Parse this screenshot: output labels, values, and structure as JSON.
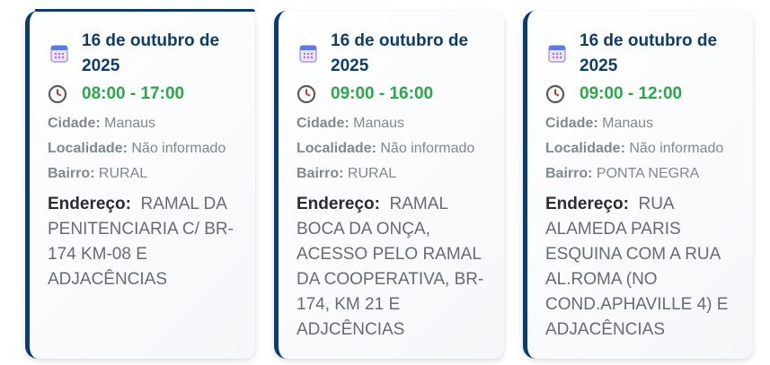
{
  "cards": [
    {
      "date": "16 de outubro de 2025",
      "time": "08:00 - 17:00",
      "cidade_label": "Cidade:",
      "cidade": "Manaus",
      "localidade_label": "Localidade:",
      "localidade": "Não informado",
      "bairro_label": "Bairro:",
      "bairro": "RURAL",
      "endereco_label": "Endereço:",
      "endereco": "RAMAL DA PENITENCIARIA C/ BR-174 KM-08 E ADJACÊNCIAS"
    },
    {
      "date": "16 de outubro de 2025",
      "time": "09:00 - 16:00",
      "cidade_label": "Cidade:",
      "cidade": "Manaus",
      "localidade_label": "Localidade:",
      "localidade": "Não informado",
      "bairro_label": "Bairro:",
      "bairro": "RURAL",
      "endereco_label": "Endereço:",
      "endereco": "RAMAL BOCA DA ONÇA, ACESSO PELO RAMAL DA COOPERATIVA, BR-174, KM 21 E ADJCÊNCIAS"
    },
    {
      "date": "16 de outubro de 2025",
      "time": "09:00 - 12:00",
      "cidade_label": "Cidade:",
      "cidade": "Manaus",
      "localidade_label": "Localidade:",
      "localidade": "Não informado",
      "bairro_label": "Bairro:",
      "bairro": "PONTA NEGRA",
      "endereco_label": "Endereço:",
      "endereco": "RUA ALAMEDA PARIS ESQUINA COM A RUA AL.ROMA (NO COND.APHAVILLE 4) E ADJACÊNCIAS"
    }
  ],
  "icons": {
    "date": "calendar-icon",
    "time": "clock-icon"
  },
  "colors": {
    "date": "#0d3e69",
    "time": "#2aa84a",
    "accent_border": "#0a3d6b"
  }
}
